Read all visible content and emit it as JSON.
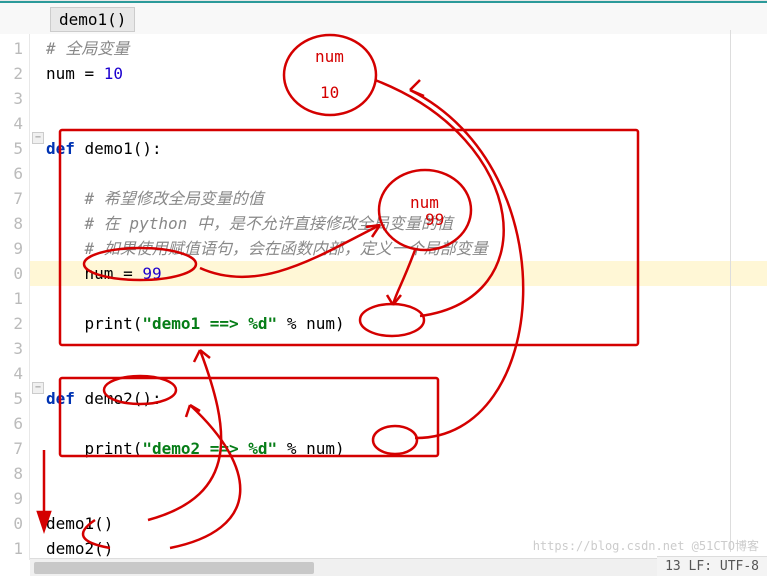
{
  "tab": "demo1()",
  "gutter": [
    "1",
    "2",
    "3",
    "4",
    "5",
    "6",
    "7",
    "8",
    "9",
    "0",
    "1",
    "2",
    "3",
    "4",
    "5",
    "6",
    "7",
    "8",
    "9",
    "0",
    "1"
  ],
  "code": {
    "l1_cmt": "# 全局变量",
    "l2_num": "num = ",
    "l2_val": "10",
    "l5_def": "def",
    "l5_name": " demo1():",
    "l7_cmt": "# 希望修改全局变量的值",
    "l8_cmt": "# 在 python 中，是不允许直接修改全局变量的值",
    "l9_cmt": "# 如果使用赋值语句，会在函数内部，定义一个局部变量",
    "l10_num": "num = ",
    "l10_val": "99",
    "l12_print": "print(",
    "l12_str": "\"demo1 ==> %d\"",
    "l12_tail": " % num)",
    "l15_def": "def",
    "l15_name": " demo2():",
    "l17_print": "print(",
    "l17_str": "\"demo2 ==> %d\"",
    "l17_tail": " % num)",
    "l20": "demo1()",
    "l21": "demo2()"
  },
  "annot": {
    "bubble1_t": "num",
    "bubble1_v": "10",
    "bubble2_t": "num",
    "bubble2_v": "99"
  },
  "status": "13 LF: UTF-8",
  "watermark": "https://blog.csdn.net @51CTO博客"
}
